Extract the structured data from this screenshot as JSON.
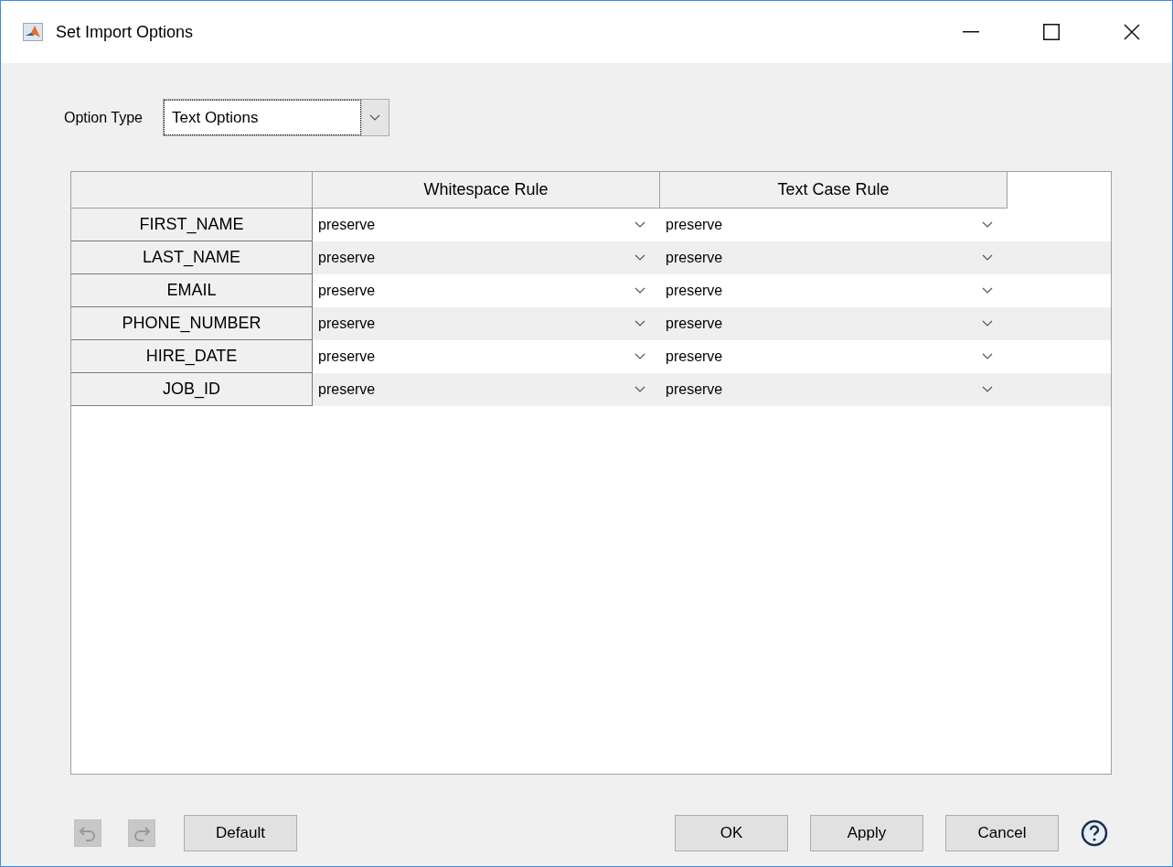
{
  "window": {
    "title": "Set Import Options"
  },
  "option_type": {
    "label": "Option Type",
    "value": "Text Options"
  },
  "table": {
    "columns": [
      "Whitespace Rule",
      "Text Case Rule"
    ],
    "rows": [
      {
        "name": "FIRST_NAME",
        "values": [
          "preserve",
          "preserve"
        ]
      },
      {
        "name": "LAST_NAME",
        "values": [
          "preserve",
          "preserve"
        ]
      },
      {
        "name": "EMAIL",
        "values": [
          "preserve",
          "preserve"
        ]
      },
      {
        "name": "PHONE_NUMBER",
        "values": [
          "preserve",
          "preserve"
        ]
      },
      {
        "name": "HIRE_DATE",
        "values": [
          "preserve",
          "preserve"
        ]
      },
      {
        "name": "JOB_ID",
        "values": [
          "preserve",
          "preserve"
        ]
      }
    ]
  },
  "undo": {
    "disabled": true
  },
  "redo": {
    "disabled": true
  },
  "buttons": {
    "left": [
      "Default"
    ],
    "right": [
      "OK",
      "Apply",
      "Cancel"
    ]
  }
}
